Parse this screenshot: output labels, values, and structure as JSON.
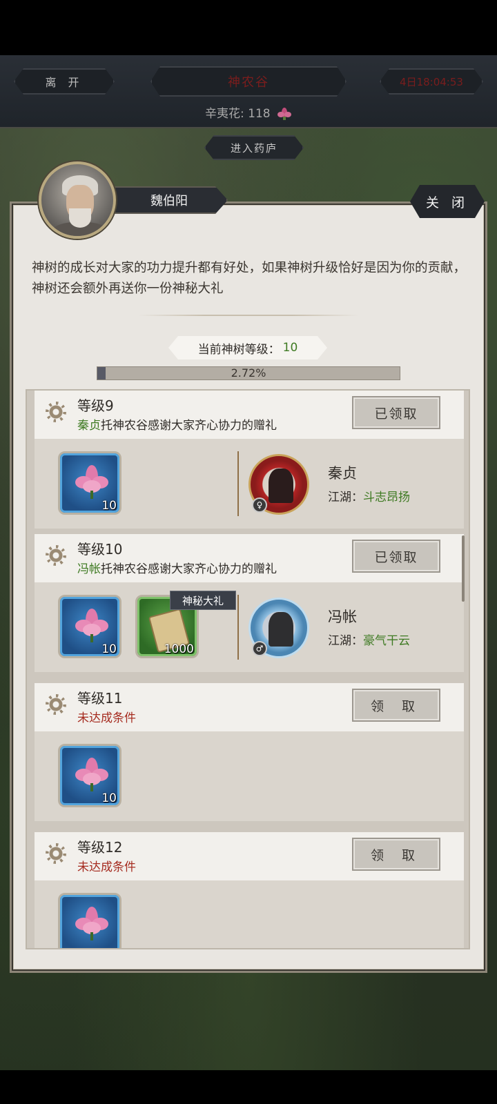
{
  "topbar": {
    "leave_label": "离 开",
    "title": "神农谷",
    "time": "4日18:04:53",
    "flower_label": "辛夷花: 118",
    "enter_label": "进入药庐"
  },
  "dialog": {
    "npc_name": "魏伯阳",
    "close_label": "关 闭",
    "description": "神树的成长对大家的功力提升都有好处，如果神树升级恰好是因为你的贡献，神树还会额外再送你一份神秘大礼",
    "level_label": "当前神树等级：",
    "level_value": "10",
    "progress_text": "2.72%",
    "progress_fraction": 0.0272
  },
  "rewards": [
    {
      "level": "等级9",
      "giver": "秦贞",
      "gift_suffix": "托神农谷感谢大家齐心协力的赠礼",
      "button": "已领取",
      "item_qty": "10",
      "npc_name": "秦贞",
      "npc_prefix": "江湖：",
      "npc_title": "斗志昂扬"
    },
    {
      "level": "等级10",
      "giver": "冯帐",
      "gift_suffix": "托神农谷感谢大家齐心协力的赠礼",
      "button": "已领取",
      "item_qty": "10",
      "mystery_tag": "神秘大礼",
      "mystery_qty": "1000",
      "npc_name": "冯帐",
      "npc_prefix": "江湖：",
      "npc_title": "豪气干云"
    },
    {
      "level": "等级11",
      "status": "未达成条件",
      "button": "领 取",
      "item_qty": "10"
    },
    {
      "level": "等级12",
      "status": "未达成条件",
      "button": "领 取"
    }
  ],
  "colors": {
    "accent_green": "#3e7a22",
    "warning_red": "#a52b1f"
  },
  "icons": [
    "flower-icon",
    "gear-icon",
    "scroll-icon",
    "female-icon",
    "male-icon"
  ]
}
